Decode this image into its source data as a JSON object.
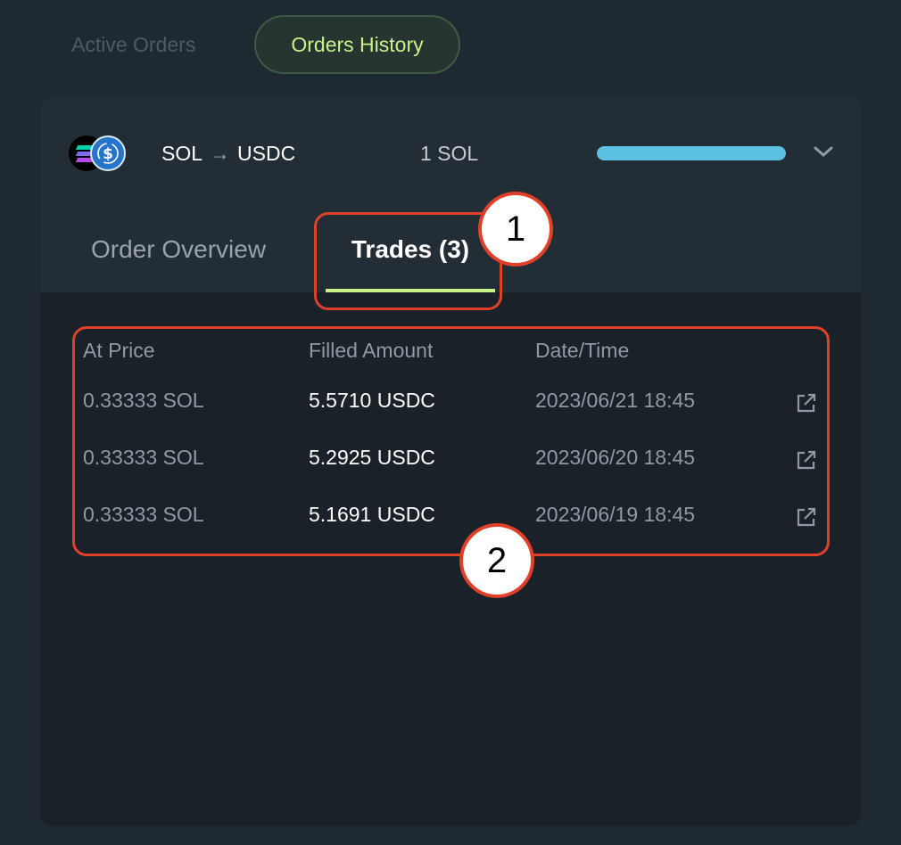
{
  "top_tabs": [
    {
      "label": "Active Orders",
      "active": false
    },
    {
      "label": "Orders History",
      "active": true
    }
  ],
  "order": {
    "from_token": "SOL",
    "to_token": "USDC",
    "amount": "1 SOL",
    "progress": 1.0,
    "icons": [
      "solana-icon",
      "usdc-icon",
      "arrow-right-icon",
      "chevron-down-icon"
    ]
  },
  "subtabs": [
    {
      "label": "Order Overview",
      "active": false
    },
    {
      "label": "Trades (3)",
      "active": true
    }
  ],
  "trades": {
    "columns": [
      "At Price",
      "Filled Amount",
      "Date/Time"
    ],
    "rows": [
      {
        "price": "0.33333 SOL",
        "filled": "5.5710 USDC",
        "datetime": "2023/06/21 18:45"
      },
      {
        "price": "0.33333 SOL",
        "filled": "5.2925 USDC",
        "datetime": "2023/06/20 18:45"
      },
      {
        "price": "0.33333 SOL",
        "filled": "5.1691 USDC",
        "datetime": "2023/06/19 18:45"
      }
    ],
    "row_icon": "external-link-icon"
  },
  "annotations": [
    "1",
    "2"
  ],
  "colors": {
    "accent": "#c7f28c",
    "progress": "#5cc1e2",
    "annotation": "#e0402a",
    "background": "#1f2931"
  }
}
